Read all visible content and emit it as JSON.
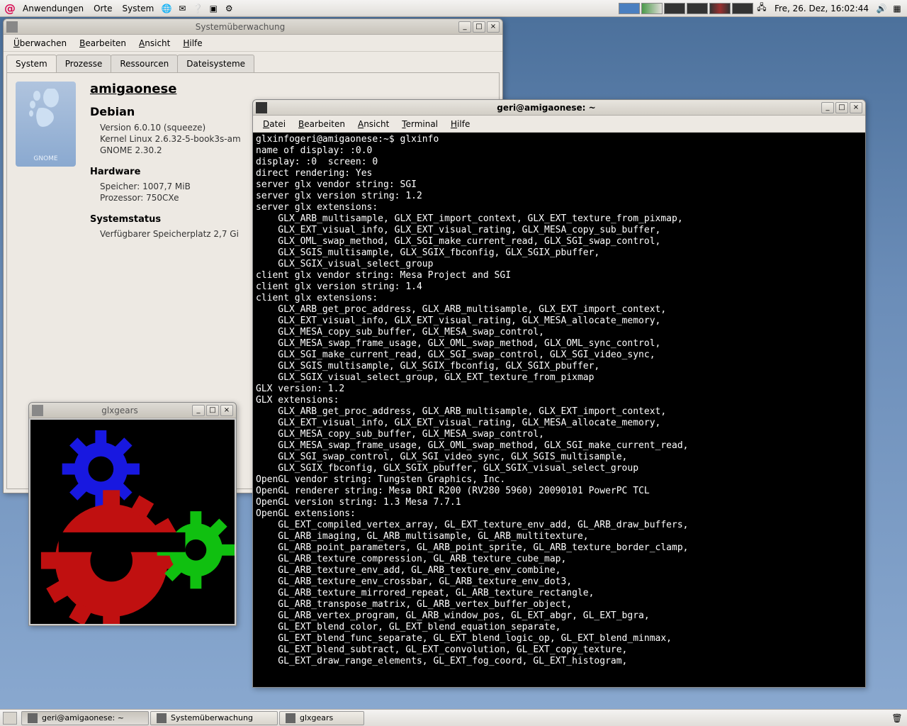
{
  "top_panel": {
    "menus": [
      "Anwendungen",
      "Orte",
      "System"
    ],
    "clock": "Fre, 26. Dez, 16:02:44"
  },
  "sysmon": {
    "title": "Systemüberwachung",
    "menus": [
      [
        "Ü",
        "berwachen"
      ],
      [
        "B",
        "earbeiten"
      ],
      [
        "A",
        "nsicht"
      ],
      [
        "H",
        "ilfe"
      ]
    ],
    "tabs": [
      "System",
      "Prozesse",
      "Ressourcen",
      "Dateisysteme"
    ],
    "hostname": "amigaonese",
    "os": "Debian",
    "version": "Version 6.0.10 (squeeze)",
    "kernel": "Kernel Linux 2.6.32-5-book3s-am",
    "gnome": "GNOME 2.30.2",
    "gnome_label": "GNOME",
    "hw_heading": "Hardware",
    "mem": "Speicher:    1007,7 MiB",
    "cpu": "Prozessor:  750CXe",
    "status_heading": "Systemstatus",
    "disk": "Verfügbarer Speicherplatz 2,7 Gi"
  },
  "terminal": {
    "title": "geri@amigaonese: ~",
    "menus": [
      [
        "D",
        "atei"
      ],
      [
        "B",
        "earbeiten"
      ],
      [
        "A",
        "nsicht"
      ],
      [
        "T",
        "erminal"
      ],
      [
        "H",
        "ilfe"
      ]
    ],
    "output": "glxinfogeri@amigaonese:~$ glxinfo\nname of display: :0.0\ndisplay: :0  screen: 0\ndirect rendering: Yes\nserver glx vendor string: SGI\nserver glx version string: 1.2\nserver glx extensions:\n    GLX_ARB_multisample, GLX_EXT_import_context, GLX_EXT_texture_from_pixmap, \n    GLX_EXT_visual_info, GLX_EXT_visual_rating, GLX_MESA_copy_sub_buffer, \n    GLX_OML_swap_method, GLX_SGI_make_current_read, GLX_SGI_swap_control, \n    GLX_SGIS_multisample, GLX_SGIX_fbconfig, GLX_SGIX_pbuffer, \n    GLX_SGIX_visual_select_group\nclient glx vendor string: Mesa Project and SGI\nclient glx version string: 1.4\nclient glx extensions:\n    GLX_ARB_get_proc_address, GLX_ARB_multisample, GLX_EXT_import_context, \n    GLX_EXT_visual_info, GLX_EXT_visual_rating, GLX_MESA_allocate_memory, \n    GLX_MESA_copy_sub_buffer, GLX_MESA_swap_control, \n    GLX_MESA_swap_frame_usage, GLX_OML_swap_method, GLX_OML_sync_control, \n    GLX_SGI_make_current_read, GLX_SGI_swap_control, GLX_SGI_video_sync, \n    GLX_SGIS_multisample, GLX_SGIX_fbconfig, GLX_SGIX_pbuffer, \n    GLX_SGIX_visual_select_group, GLX_EXT_texture_from_pixmap\nGLX version: 1.2\nGLX extensions:\n    GLX_ARB_get_proc_address, GLX_ARB_multisample, GLX_EXT_import_context, \n    GLX_EXT_visual_info, GLX_EXT_visual_rating, GLX_MESA_allocate_memory, \n    GLX_MESA_copy_sub_buffer, GLX_MESA_swap_control, \n    GLX_MESA_swap_frame_usage, GLX_OML_swap_method, GLX_SGI_make_current_read, \n    GLX_SGI_swap_control, GLX_SGI_video_sync, GLX_SGIS_multisample, \n    GLX_SGIX_fbconfig, GLX_SGIX_pbuffer, GLX_SGIX_visual_select_group\nOpenGL vendor string: Tungsten Graphics, Inc.\nOpenGL renderer string: Mesa DRI R200 (RV280 5960) 20090101 PowerPC TCL\nOpenGL version string: 1.3 Mesa 7.7.1\nOpenGL extensions:\n    GL_EXT_compiled_vertex_array, GL_EXT_texture_env_add, GL_ARB_draw_buffers, \n    GL_ARB_imaging, GL_ARB_multisample, GL_ARB_multitexture, \n    GL_ARB_point_parameters, GL_ARB_point_sprite, GL_ARB_texture_border_clamp, \n    GL_ARB_texture_compression, GL_ARB_texture_cube_map, \n    GL_ARB_texture_env_add, GL_ARB_texture_env_combine, \n    GL_ARB_texture_env_crossbar, GL_ARB_texture_env_dot3, \n    GL_ARB_texture_mirrored_repeat, GL_ARB_texture_rectangle, \n    GL_ARB_transpose_matrix, GL_ARB_vertex_buffer_object, \n    GL_ARB_vertex_program, GL_ARB_window_pos, GL_EXT_abgr, GL_EXT_bgra, \n    GL_EXT_blend_color, GL_EXT_blend_equation_separate, \n    GL_EXT_blend_func_separate, GL_EXT_blend_logic_op, GL_EXT_blend_minmax, \n    GL_EXT_blend_subtract, GL_EXT_convolution, GL_EXT_copy_texture, \n    GL_EXT_draw_range_elements, GL_EXT_fog_coord, GL_EXT_histogram, "
  },
  "glxgears": {
    "title": "glxgears"
  },
  "taskbar": {
    "tasks": [
      "geri@amigaonese: ~",
      "Systemüberwachung",
      "glxgears"
    ]
  }
}
